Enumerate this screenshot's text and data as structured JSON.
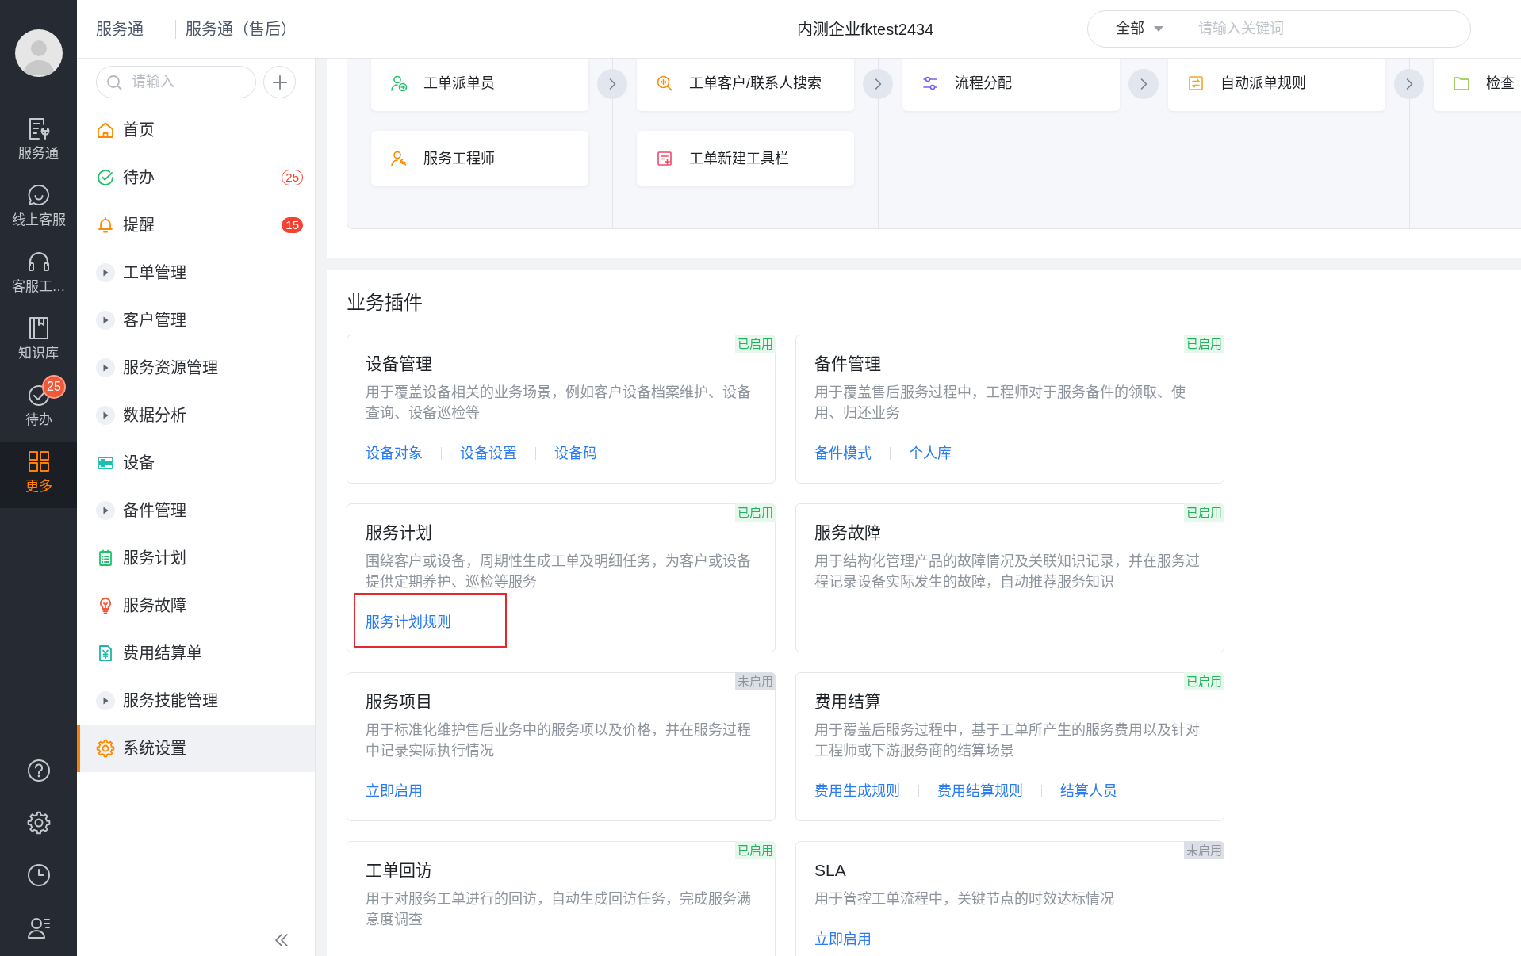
{
  "header": {
    "app_name": "服务通",
    "module_name": "服务通（售后）",
    "title": "内测企业fktest2434",
    "search": {
      "scope": "全部",
      "placeholder": "请输入关键词"
    }
  },
  "rail": {
    "items": [
      {
        "label": "服务通",
        "selected": false
      },
      {
        "label": "线上客服",
        "selected": false
      },
      {
        "label": "客服工…",
        "selected": false
      },
      {
        "label": "知识库",
        "selected": false
      },
      {
        "label": "待办",
        "selected": false,
        "badge": "25"
      },
      {
        "label": "更多",
        "selected": true
      }
    ]
  },
  "sidebar": {
    "search": {
      "placeholder": "请输入"
    },
    "items": [
      {
        "label": "首页",
        "kind": "page",
        "selected": false
      },
      {
        "label": "待办",
        "kind": "page",
        "selected": false,
        "badge": {
          "text": "25",
          "filled": false
        }
      },
      {
        "label": "提醒",
        "kind": "page",
        "selected": false,
        "badge": {
          "text": "15",
          "filled": true
        }
      },
      {
        "label": "工单管理",
        "kind": "group",
        "selected": false
      },
      {
        "label": "客户管理",
        "kind": "group",
        "selected": false
      },
      {
        "label": "服务资源管理",
        "kind": "group",
        "selected": false
      },
      {
        "label": "数据分析",
        "kind": "group",
        "selected": false
      },
      {
        "label": "设备",
        "kind": "page",
        "selected": false
      },
      {
        "label": "备件管理",
        "kind": "group",
        "selected": false
      },
      {
        "label": "服务计划",
        "kind": "page",
        "selected": false
      },
      {
        "label": "服务故障",
        "kind": "page",
        "selected": false
      },
      {
        "label": "费用结算单",
        "kind": "page",
        "selected": false
      },
      {
        "label": "服务技能管理",
        "kind": "group",
        "selected": false
      },
      {
        "label": "系统设置",
        "kind": "page",
        "selected": true
      }
    ]
  },
  "tools": {
    "columns": [
      {
        "items": [
          "工单派单员",
          "服务工程师"
        ]
      },
      {
        "items": [
          "工单客户/联系人搜索",
          "工单新建工具栏"
        ]
      },
      {
        "items": [
          "流程分配"
        ]
      },
      {
        "items": [
          "自动派单规则"
        ]
      },
      {
        "items": [
          "检查"
        ]
      }
    ]
  },
  "plugins": {
    "title": "业务插件",
    "cards": [
      {
        "title": "设备管理",
        "status": "已启用",
        "enabled": true,
        "description": "用于覆盖设备相关的业务场景，例如客户设备档案维护、设备查询、设备巡检等",
        "links": [
          {
            "label": "设备对象",
            "highlighted": false
          },
          {
            "label": "设备设置",
            "highlighted": false
          },
          {
            "label": "设备码",
            "highlighted": false
          }
        ]
      },
      {
        "title": "备件管理",
        "status": "已启用",
        "enabled": true,
        "description": "用于覆盖售后服务过程中，工程师对于服务备件的领取、使用、归还业务",
        "links": [
          {
            "label": "备件模式",
            "highlighted": false
          },
          {
            "label": "个人库",
            "highlighted": false
          }
        ]
      },
      {
        "title": "服务计划",
        "status": "已启用",
        "enabled": true,
        "description": "围绕客户或设备，周期性生成工单及明细任务，为客户或设备提供定期养护、巡检等服务",
        "links": [
          {
            "label": "服务计划规则",
            "highlighted": true
          }
        ]
      },
      {
        "title": "服务故障",
        "status": "已启用",
        "enabled": true,
        "description": "用于结构化管理产品的故障情况及关联知识记录，并在服务过程记录设备实际发生的故障，自动推荐服务知识"
      },
      {
        "title": "服务项目",
        "status": "未启用",
        "enabled": false,
        "description": "用于标准化维护售后业务中的服务项以及价格，并在服务过程中记录实际执行情况",
        "links": [
          {
            "label": "立即启用",
            "highlighted": false
          }
        ]
      },
      {
        "title": "费用结算",
        "status": "已启用",
        "enabled": true,
        "description": "用于覆盖后服务过程中，基于工单所产生的服务费用以及针对工程师或下游服务商的结算场景",
        "links": [
          {
            "label": "费用生成规则",
            "highlighted": false
          },
          {
            "label": "费用结算规则",
            "highlighted": false
          },
          {
            "label": "结算人员",
            "highlighted": false
          }
        ]
      },
      {
        "title": "工单回访",
        "status": "已启用",
        "enabled": true,
        "description": "用于对服务工单进行的回访，自动生成回访任务，完成服务满意度调查"
      },
      {
        "title": "SLA",
        "status": "未启用",
        "enabled": false,
        "description": "用于管控工单流程中，关键节点的时效达标情况",
        "links": [
          {
            "label": "立即启用",
            "highlighted": false
          }
        ]
      }
    ]
  }
}
